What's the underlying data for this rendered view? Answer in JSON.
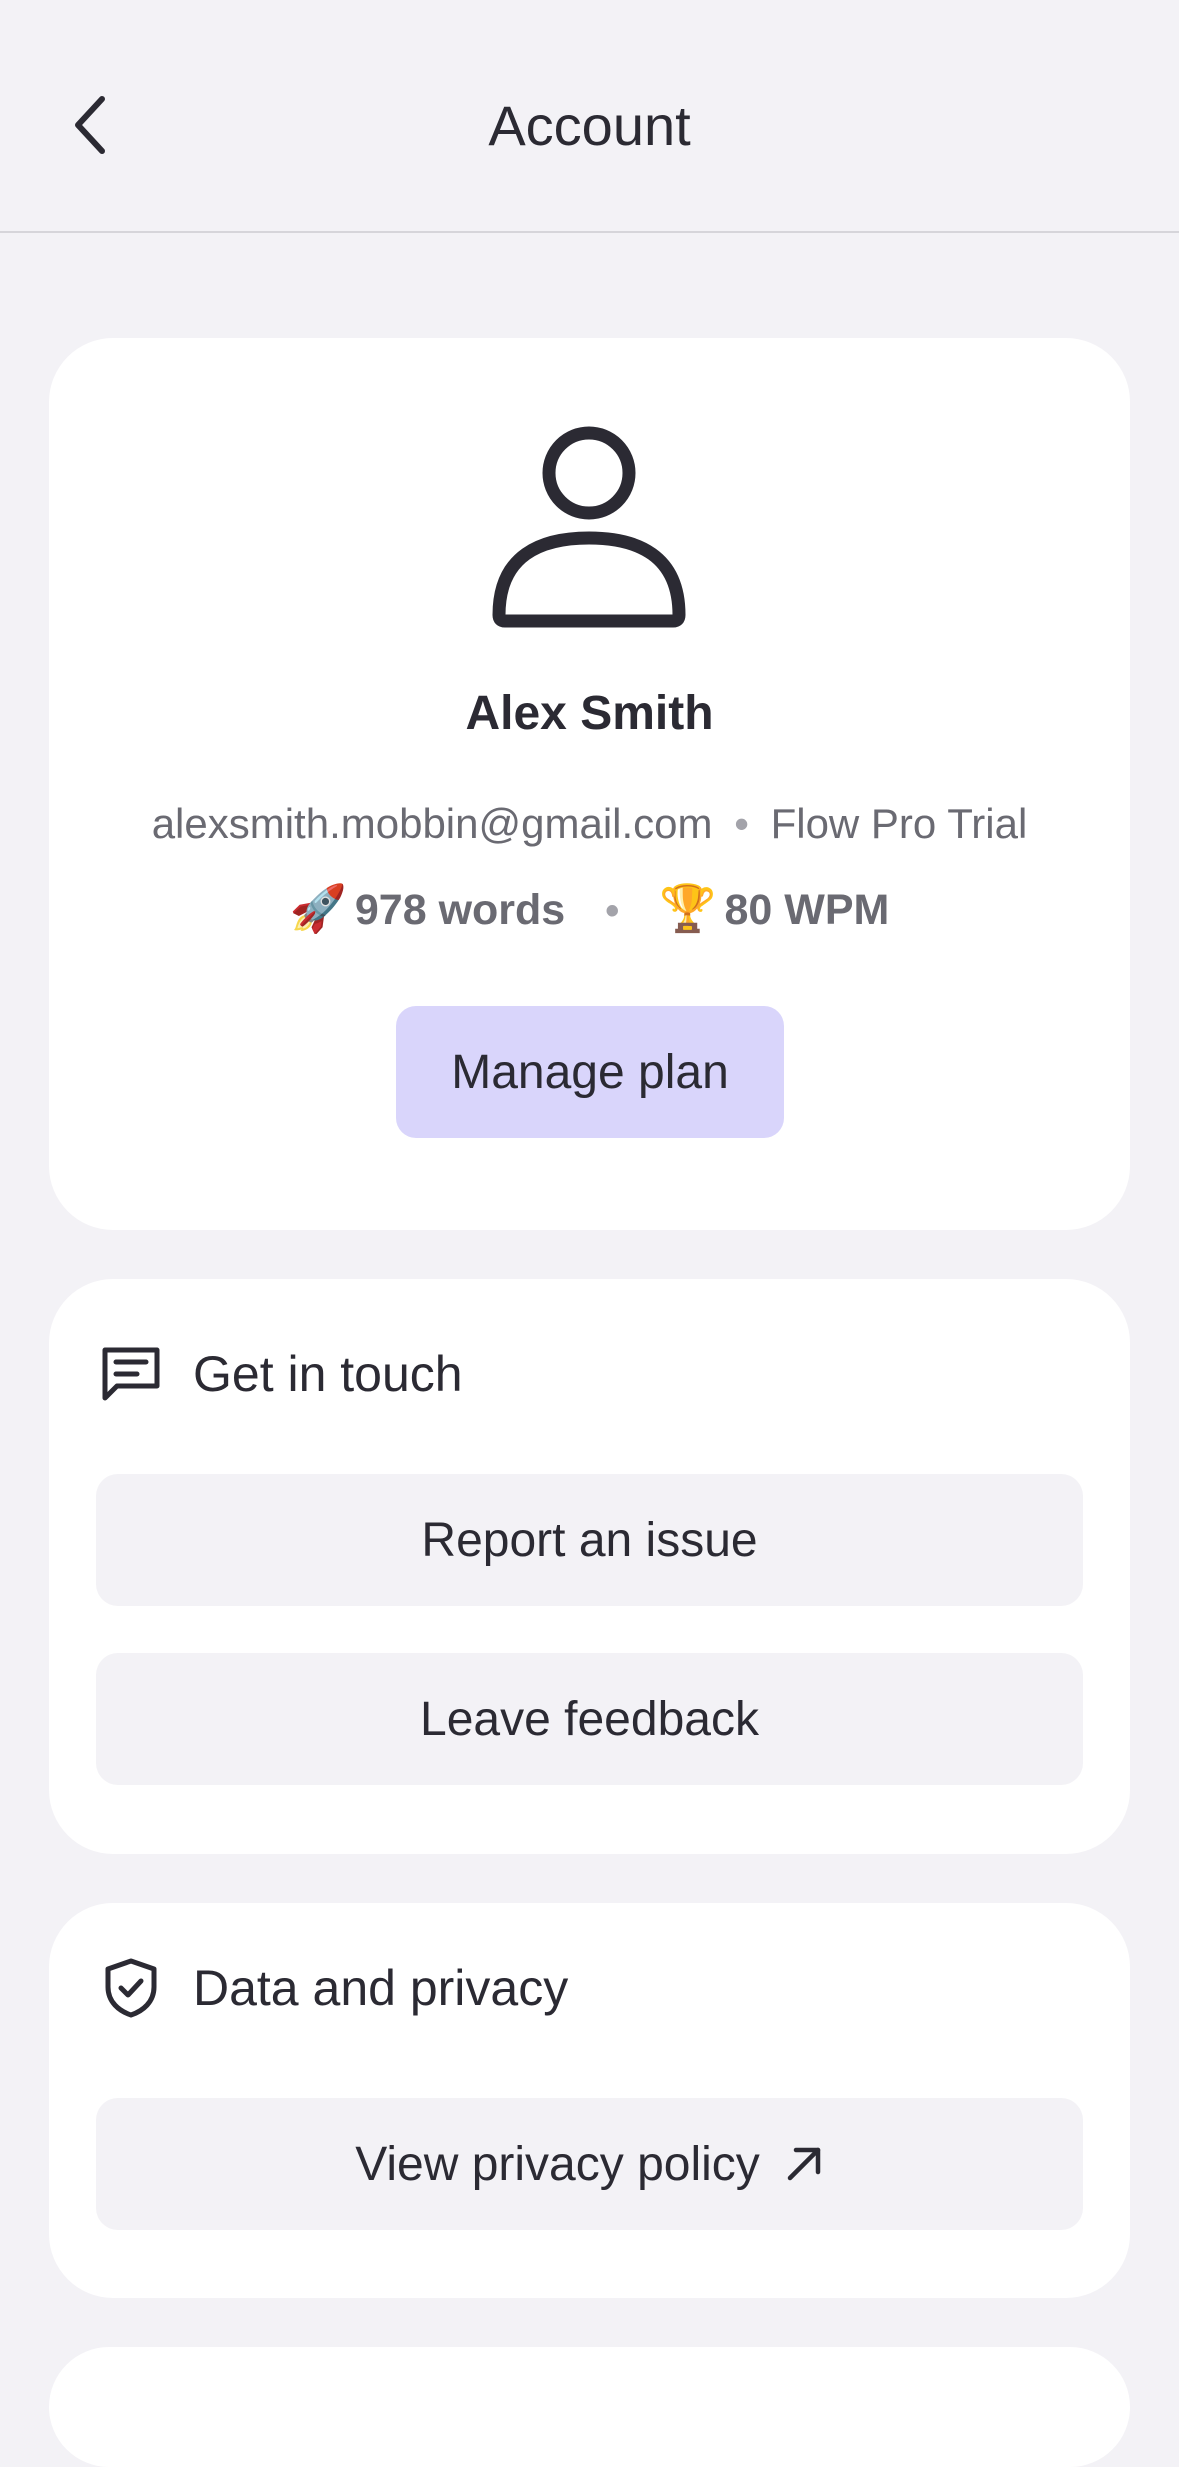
{
  "header": {
    "title": "Account",
    "back_icon": "chevron-left-icon"
  },
  "profile": {
    "avatar_icon": "user-icon",
    "name": "Alex Smith",
    "email": "alexsmith.mobbin@gmail.com",
    "separator": "•",
    "plan": "Flow Pro Trial",
    "stats": {
      "words_emoji": "🚀",
      "words": "978 words",
      "separator": "•",
      "wpm_emoji": "🏆",
      "wpm": "80 WPM"
    },
    "manage_button": "Manage plan"
  },
  "get_in_touch": {
    "icon": "message-icon",
    "title": "Get in touch",
    "report_button": "Report an issue",
    "feedback_button": "Leave feedback"
  },
  "privacy": {
    "icon": "shield-check-icon",
    "title": "Data and privacy",
    "policy_button": "View privacy policy",
    "policy_icon": "arrow-up-right-icon"
  },
  "colors": {
    "background": "#f3f2f6",
    "card": "#ffffff",
    "accent_button": "#d9d5fb",
    "text": "#2b2a33",
    "muted_text": "#6a6a72"
  }
}
